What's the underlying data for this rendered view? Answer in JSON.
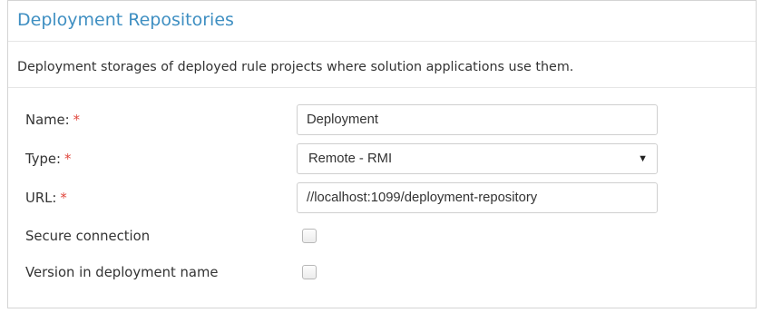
{
  "panel": {
    "title": "Deployment Repositories",
    "description": "Deployment storages of deployed rule projects where solution applications use them."
  },
  "form": {
    "name": {
      "label": "Name:",
      "required_mark": "*",
      "value": "Deployment"
    },
    "type": {
      "label": "Type:",
      "required_mark": "*",
      "selected": "Remote - RMI"
    },
    "url": {
      "label": "URL:",
      "required_mark": "*",
      "value": "//localhost:1099/deployment-repository"
    },
    "secure_connection": {
      "label": "Secure connection",
      "checked": false
    },
    "version_in_name": {
      "label": "Version in deployment name",
      "checked": false
    }
  },
  "colors": {
    "title": "#3f8fc2",
    "required": "#e0463c",
    "border": "#d4d4d4"
  },
  "icons": {
    "select_caret": "caret-down-icon"
  }
}
